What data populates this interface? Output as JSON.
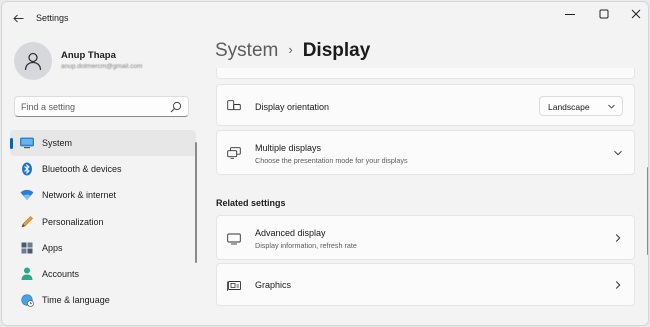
{
  "window": {
    "title": "Settings"
  },
  "user": {
    "name": "Anup Thapa",
    "email": "anup.dotmercm@gmail.com"
  },
  "search": {
    "placeholder": "Find a setting"
  },
  "sidebar": {
    "items": [
      {
        "label": "System",
        "icon": "monitor-icon",
        "active": true
      },
      {
        "label": "Bluetooth & devices",
        "icon": "bluetooth-icon",
        "active": false
      },
      {
        "label": "Network & internet",
        "icon": "wifi-icon",
        "active": false
      },
      {
        "label": "Personalization",
        "icon": "pencil-icon",
        "active": false
      },
      {
        "label": "Apps",
        "icon": "apps-grid-icon",
        "active": false
      },
      {
        "label": "Accounts",
        "icon": "person-icon",
        "active": false
      },
      {
        "label": "Time & language",
        "icon": "globe-clock-icon",
        "active": false
      }
    ]
  },
  "breadcrumb": {
    "parent": "System",
    "separator": "›",
    "current": "Display"
  },
  "cards": {
    "orientation": {
      "title": "Display orientation",
      "value": "Landscape",
      "icon": "display-orientation-icon"
    },
    "multiple_displays": {
      "title": "Multiple displays",
      "subtitle": "Choose the presentation mode for your displays",
      "icon": "multiple-displays-icon"
    }
  },
  "related_settings": {
    "header": "Related settings",
    "advanced_display": {
      "title": "Advanced display",
      "subtitle": "Display information, refresh rate",
      "icon": "monitor-outline-icon"
    },
    "graphics": {
      "title": "Graphics",
      "icon": "graphics-card-icon"
    }
  },
  "colors": {
    "accent": "#0067c0",
    "background": "#f3f3f3",
    "card": "#fbfbfb"
  }
}
